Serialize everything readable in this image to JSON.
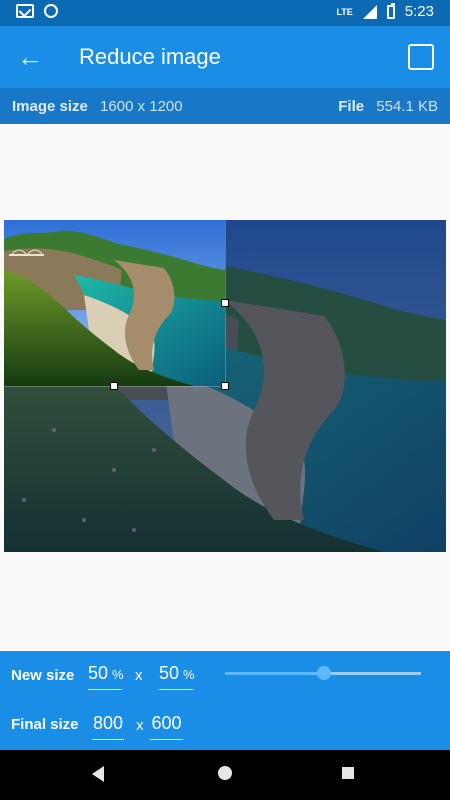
{
  "status_bar": {
    "time": "5:23",
    "network": "LTE",
    "icons": [
      "gmail-icon",
      "globe-icon",
      "lte-icon",
      "signal-icon",
      "battery-icon"
    ]
  },
  "toolbar": {
    "title": "Reduce image",
    "back_icon": "arrow-left-icon",
    "save_icon": "save-icon"
  },
  "info": {
    "image_size_label": "Image size",
    "image_size_value": "1600 x 1200",
    "file_label": "File",
    "file_value": "554.1 KB"
  },
  "controls": {
    "new_size_label": "New size",
    "width_percent": "50",
    "height_percent": "50",
    "percent_unit": "%",
    "times": "x",
    "slider_value": 0.5,
    "final_size_label": "Final size",
    "final_width": "800",
    "final_height": "600"
  },
  "navigation": {
    "back": "back-triangle-icon",
    "home": "home-circle-icon",
    "recents": "recents-square-icon"
  },
  "colors": {
    "primary": "#1a8ee6",
    "status": "#0c6ab5",
    "info": "#1877c7",
    "accent": "#5fb9ff"
  }
}
